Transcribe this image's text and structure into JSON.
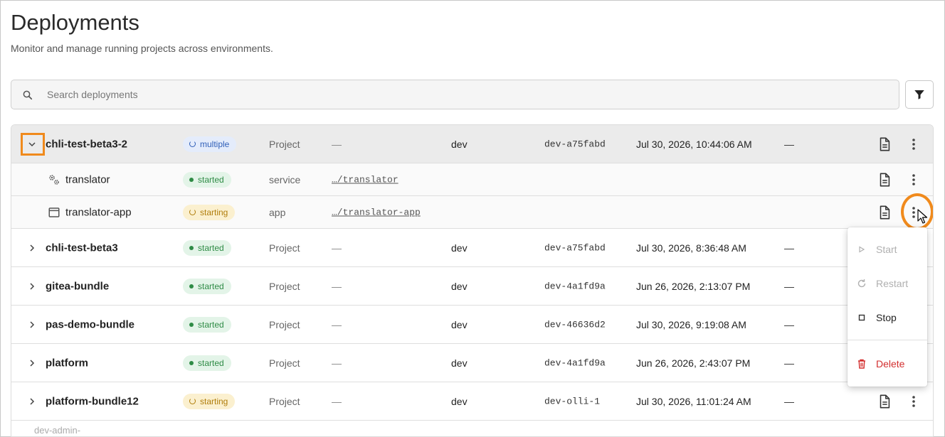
{
  "page": {
    "title": "Deployments",
    "subtitle": "Monitor and manage running projects across environments."
  },
  "search": {
    "placeholder": "Search deployments"
  },
  "rows": [
    {
      "name": "chli-test-beta3-2",
      "status": "multiple",
      "type": "Project",
      "path": "—",
      "env": "dev",
      "version": "dev-a75fabd",
      "date": "Jul 30, 2026, 10:44:06 AM",
      "extra": "—"
    },
    {
      "name": "translator",
      "status": "started",
      "type": "service",
      "path": "…/translator"
    },
    {
      "name": "translator-app",
      "status": "starting",
      "type": "app",
      "path": "…/translator-app"
    },
    {
      "name": "chli-test-beta3",
      "status": "started",
      "type": "Project",
      "path": "—",
      "env": "dev",
      "version": "dev-a75fabd",
      "date": "Jul 30, 2026, 8:36:48 AM",
      "extra": "—"
    },
    {
      "name": "gitea-bundle",
      "status": "started",
      "type": "Project",
      "path": "—",
      "env": "dev",
      "version": "dev-4a1fd9a",
      "date": "Jun 26, 2026, 2:13:07 PM",
      "extra": "—"
    },
    {
      "name": "pas-demo-bundle",
      "status": "started",
      "type": "Project",
      "path": "—",
      "env": "dev",
      "version": "dev-46636d2",
      "date": "Jul 30, 2026, 9:19:08 AM",
      "extra": "—"
    },
    {
      "name": "platform",
      "status": "started",
      "type": "Project",
      "path": "—",
      "env": "dev",
      "version": "dev-4a1fd9a",
      "date": "Jun 26, 2026, 2:43:07 PM",
      "extra": "—"
    },
    {
      "name": "platform-bundle12",
      "status": "starting",
      "type": "Project",
      "path": "—",
      "env": "dev",
      "version": "dev-olli-1",
      "date": "Jul 30, 2026, 11:01:24 AM",
      "extra": "—"
    },
    {
      "name": "dev-admin-"
    }
  ],
  "menu": {
    "start": "Start",
    "restart": "Restart",
    "stop": "Stop",
    "delete": "Delete"
  },
  "colors": {
    "highlight": "#f08a1c",
    "started": "#2e8b45",
    "starting": "#b07d0a",
    "multiple": "#2f5fb8",
    "danger": "#d32f2f"
  }
}
